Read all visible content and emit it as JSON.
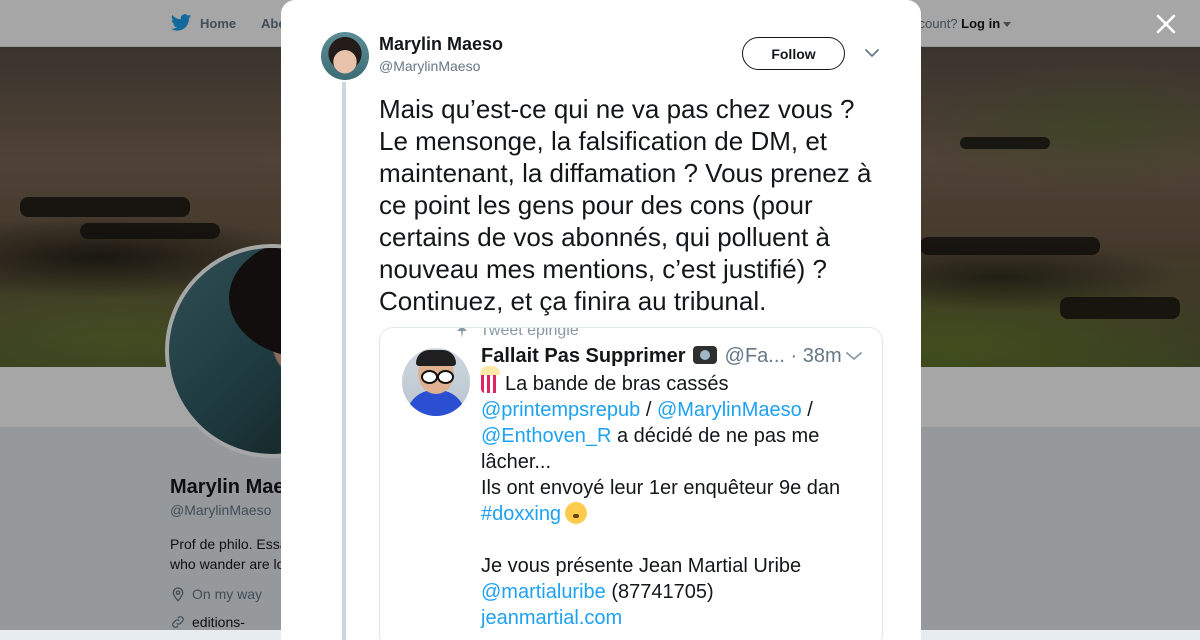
{
  "nav": {
    "home_label": "Home",
    "about_label": "Abo",
    "account_text": "ccount?",
    "login_label": "Log in"
  },
  "profile": {
    "name": "Marylin Maeso",
    "handle": "@MarylinMaeso",
    "bio_line1": "Prof de philo. Essayiste.",
    "bio_line2": "who wander are lost.",
    "location": "On my way",
    "link": "editions-"
  },
  "tweet": {
    "author_name": "Marylin Maeso",
    "author_handle": "@MarylinMaeso",
    "follow_label": "Follow",
    "text": "Mais qu’est-ce qui ne va pas chez vous ? Le mensonge, la falsification de DM, et maintenant, la diffamation ? Vous prenez à ce point les gens pour des cons (pour certains de vos abonnés, qui polluent à nouveau mes mentions, c’est justifié) ? Continuez, et ça finira au tribunal."
  },
  "embed": {
    "pinned_label": "Tweet épinglé",
    "name": "Fallait Pas Supprimer",
    "handle_time": "@Fa... · 38m",
    "line1_text": "La bande de bras cassés",
    "mention1": "@printempsrepub",
    "sep1": " / ",
    "mention2": "@MarylinMaeso",
    "sep2": " /",
    "mention3": "@Enthoven_R",
    "line3_rest": " a décidé de ne pas me lâcher...",
    "line4": "Ils ont envoyé leur 1er enquêteur 9e dan",
    "hashtag": "#doxxing",
    "line6": "Je vous présente Jean Martial Uribe",
    "mention4": "@martialuribe",
    "phone": " (87741705)",
    "website": "jeanmartial.com"
  },
  "colors": {
    "twitter_blue": "#1da1f2",
    "text_primary": "#14171a",
    "text_secondary": "#657786",
    "overlay": "rgba(0,0,0,0.35)"
  },
  "icons": {
    "nav_home": "twitter-bird-icon",
    "close": "close-icon",
    "caret": "chevron-down-icon",
    "pin": "pin-icon",
    "location": "location-pin-icon",
    "link": "link-icon"
  }
}
